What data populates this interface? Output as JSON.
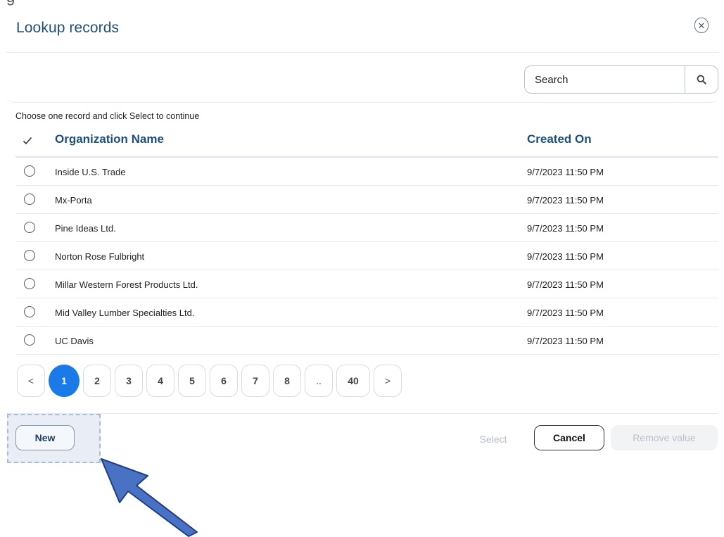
{
  "cut_glyph": "g",
  "dialog": {
    "title": "Lookup records",
    "close_icon": "close-icon"
  },
  "search": {
    "placeholder": "Search",
    "icon": "search-icon"
  },
  "instruction": "Choose one record and click Select to continue",
  "table": {
    "columns": [
      "Organization Name",
      "Created On"
    ],
    "rows": [
      {
        "name": "Inside U.S. Trade",
        "created": "9/7/2023 11:50 PM"
      },
      {
        "name": "Mx-Porta",
        "created": "9/7/2023 11:50 PM"
      },
      {
        "name": "Pine Ideas Ltd.",
        "created": "9/7/2023 11:50 PM"
      },
      {
        "name": "Norton Rose Fulbright",
        "created": "9/7/2023 11:50 PM"
      },
      {
        "name": "Millar Western Forest Products Ltd.",
        "created": "9/7/2023 11:50 PM"
      },
      {
        "name": "Mid Valley Lumber Specialties Ltd.",
        "created": "9/7/2023 11:50 PM"
      },
      {
        "name": "UC Davis",
        "created": "9/7/2023 11:50 PM"
      }
    ]
  },
  "pagination": {
    "prev": "<",
    "pages": [
      "1",
      "2",
      "3",
      "4",
      "5",
      "6",
      "7",
      "8",
      "..",
      "40"
    ],
    "next": ">",
    "current": "1"
  },
  "footer": {
    "new_label": "New",
    "select_label": "Select",
    "cancel_label": "Cancel",
    "remove_label": "Remove value"
  },
  "colors": {
    "title": "#1f4e79",
    "active_page": "#1a7ae8",
    "arrow": "#4a72c4"
  }
}
